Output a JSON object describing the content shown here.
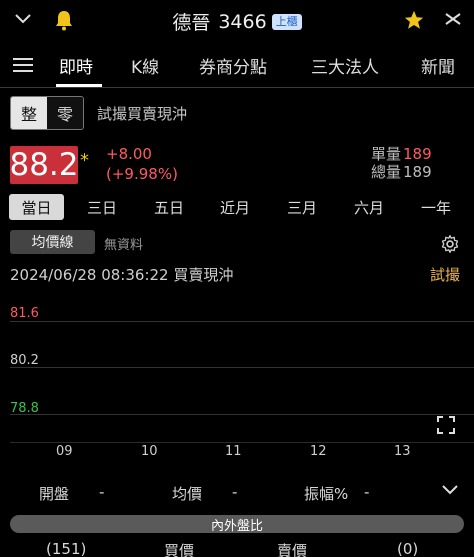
{
  "header": {
    "name": "德晉",
    "code": "3466",
    "market_badge": "上櫃"
  },
  "tabs": [
    "即時",
    "K線",
    "券商分點",
    "三大法人",
    "新聞"
  ],
  "lot_toggle": {
    "whole": "整",
    "odd": "零"
  },
  "trial_label": "試撮買賣現沖",
  "quote": {
    "price": "88.2",
    "mark": "*",
    "change": "+8.00",
    "change_pct": "(+9.98%)",
    "unit_vol_label": "單量",
    "unit_vol": "189",
    "total_vol_label": "總量",
    "total_vol": "189"
  },
  "periods": [
    "當日",
    "三日",
    "五日",
    "近月",
    "三月",
    "六月",
    "一年"
  ],
  "avg_line": {
    "label": "均價線",
    "status": "無資料"
  },
  "timestamp": "2024/06/28 08:36:22  買賣現沖",
  "trial_right": "試撮",
  "chart_data": {
    "type": "line",
    "y_ticks": [
      "81.6",
      "80.2",
      "78.8"
    ],
    "x_ticks": [
      "09",
      "10",
      "11",
      "12",
      "13"
    ],
    "ylim": [
      78.8,
      81.6
    ],
    "series": []
  },
  "stats": {
    "open_label": "開盤",
    "open": "-",
    "avg_label": "均價",
    "avg": "-",
    "amp_label": "振幅%",
    "amp": "-"
  },
  "inout": {
    "title": "內外盤比",
    "left_count": "(151)",
    "buy_label": "買價",
    "sell_label": "賣價",
    "right_count": "(0)"
  },
  "colors": {
    "up": "#ff5a5f",
    "price_bg": "#c9303a",
    "down": "#39c24a",
    "accent": "#f0b44c"
  }
}
